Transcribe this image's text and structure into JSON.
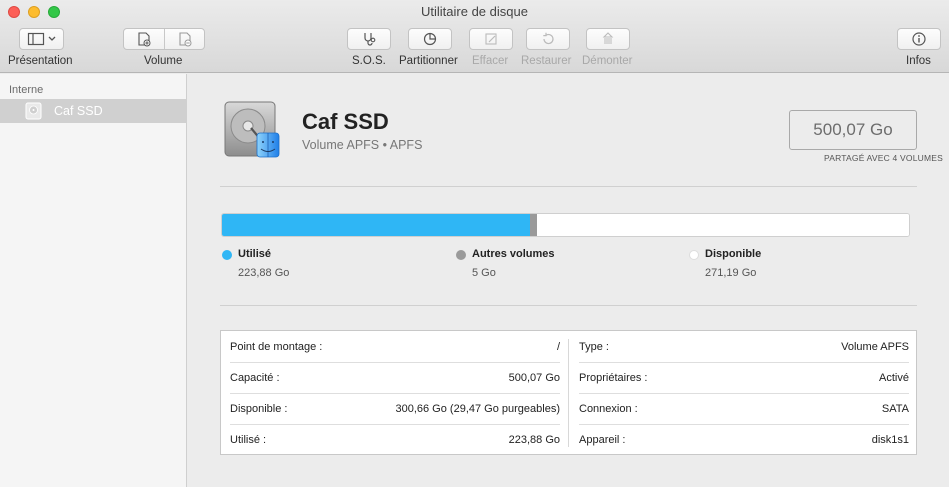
{
  "window": {
    "title": "Utilitaire de disque"
  },
  "toolbar": {
    "presentation_label": "Présentation",
    "volume_label": "Volume",
    "sos_label": "S.O.S.",
    "partition_label": "Partitionner",
    "erase_label": "Effacer",
    "restore_label": "Restaurer",
    "unmount_label": "Démonter",
    "info_label": "Infos"
  },
  "sidebar": {
    "section": "Interne",
    "items": [
      {
        "label": "Caf SSD",
        "icon": "internal-disk-icon",
        "selected": true
      }
    ]
  },
  "volume": {
    "name": "Caf SSD",
    "subtitle": "Volume APFS • APFS",
    "capacity": "500,07 Go",
    "shared_note": "PARTAGÉ AVEC 4 VOLUMES"
  },
  "usage": {
    "total_go": 500.07,
    "segments": [
      {
        "name": "Utilisé",
        "value": "223,88 Go",
        "amount_go": 223.88,
        "color": "#2fb6f5"
      },
      {
        "name": "Autres volumes",
        "value": "5 Go",
        "amount_go": 5,
        "color": "#9a9a9a"
      },
      {
        "name": "Disponible",
        "value": "271,19 Go",
        "amount_go": 271.19,
        "color": "#ffffff"
      }
    ]
  },
  "details": {
    "left": [
      {
        "key": "Point de montage :",
        "value": "/"
      },
      {
        "key": "Capacité :",
        "value": "500,07 Go"
      },
      {
        "key": "Disponible :",
        "value": "300,66 Go (29,47 Go purgeables)"
      },
      {
        "key": "Utilisé :",
        "value": "223,88 Go"
      }
    ],
    "right": [
      {
        "key": "Type :",
        "value": "Volume APFS"
      },
      {
        "key": "Propriétaires :",
        "value": "Activé"
      },
      {
        "key": "Connexion :",
        "value": "SATA"
      },
      {
        "key": "Appareil :",
        "value": "disk1s1"
      }
    ]
  }
}
